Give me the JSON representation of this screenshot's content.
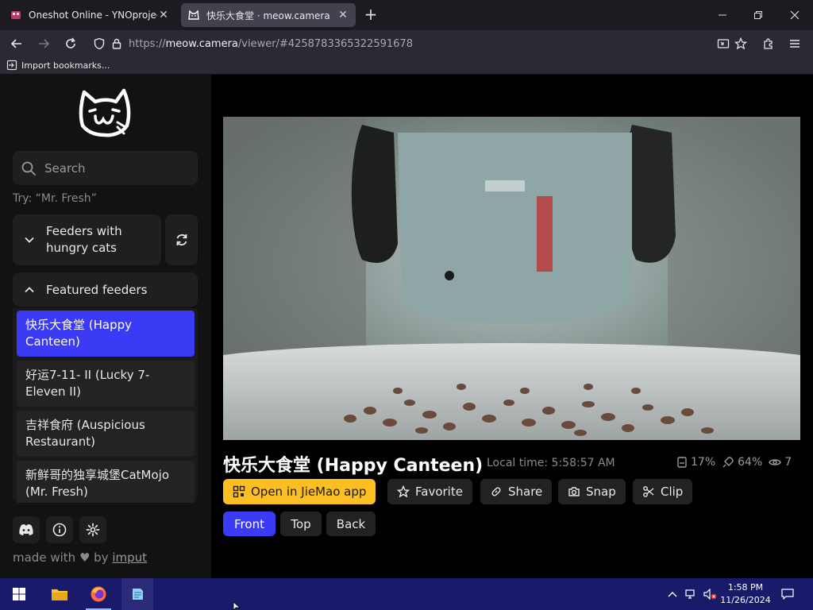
{
  "browser": {
    "tabs": [
      {
        "title": "Oneshot Online - YNOproject",
        "active": false
      },
      {
        "title": "快乐大食堂 · meow.camera",
        "active": true
      }
    ],
    "url": {
      "scheme": "https://",
      "host": "meow.camera",
      "path": "/viewer/#4258783365322591678"
    },
    "bookmark_label": "Import bookmarks..."
  },
  "sidebar": {
    "search_placeholder": "Search",
    "hint": "Try: “Mr. Fresh”",
    "group_hungry": "Feeders with hungry cats",
    "group_featured": "Featured feeders",
    "feeders": [
      {
        "label": "快乐大食堂 (Happy Canteen)",
        "active": true
      },
      {
        "label": "好运7-11- II  (Lucky 7-Eleven II)",
        "active": false
      },
      {
        "label": "吉祥食府 (Auspicious Restaurant)",
        "active": false
      },
      {
        "label": "新鲜哥的独享城堡CatMojo (Mr. Fresh)",
        "active": false
      }
    ],
    "made_with_prefix": "made with",
    "made_with_by": "by",
    "made_with_author": "imput"
  },
  "viewer": {
    "title": "快乐大食堂 (Happy Canteen)",
    "local_time": "Local time: 5:58:57 AM",
    "stats": {
      "food": "17%",
      "battery": "64%",
      "viewers": "7"
    },
    "actions": {
      "open_app": "Open in JieMao app",
      "favorite": "Favorite",
      "share": "Share",
      "snap": "Snap",
      "clip": "Clip"
    },
    "views": [
      {
        "label": "Front",
        "active": true
      },
      {
        "label": "Top",
        "active": false
      },
      {
        "label": "Back",
        "active": false
      }
    ]
  },
  "taskbar": {
    "time": "1:58 PM",
    "date": "11/26/2024"
  },
  "colors": {
    "accent_blue": "#3b3bf5",
    "accent_yellow": "#fbbf24",
    "taskbar": "#1a1a6a"
  }
}
